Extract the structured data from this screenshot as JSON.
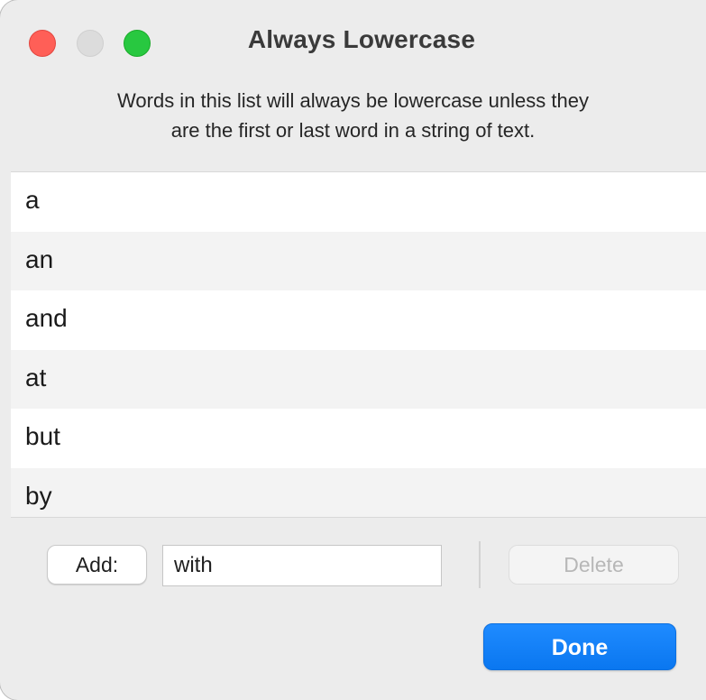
{
  "window": {
    "title": "Always Lowercase",
    "description_line1": "Words in this list will always be lowercase unless they",
    "description_line2": "are the first or last word in a string of text."
  },
  "list": {
    "items": [
      "a",
      "an",
      "and",
      "at",
      "but",
      "by"
    ]
  },
  "controls": {
    "add_label": "Add:",
    "input_value": "with",
    "delete_label": "Delete",
    "delete_enabled": false,
    "done_label": "Done"
  },
  "colors": {
    "close": "#ff5f57",
    "minimize": "#dcdcdc",
    "zoom": "#28c840",
    "accent": "#0a7aff"
  }
}
